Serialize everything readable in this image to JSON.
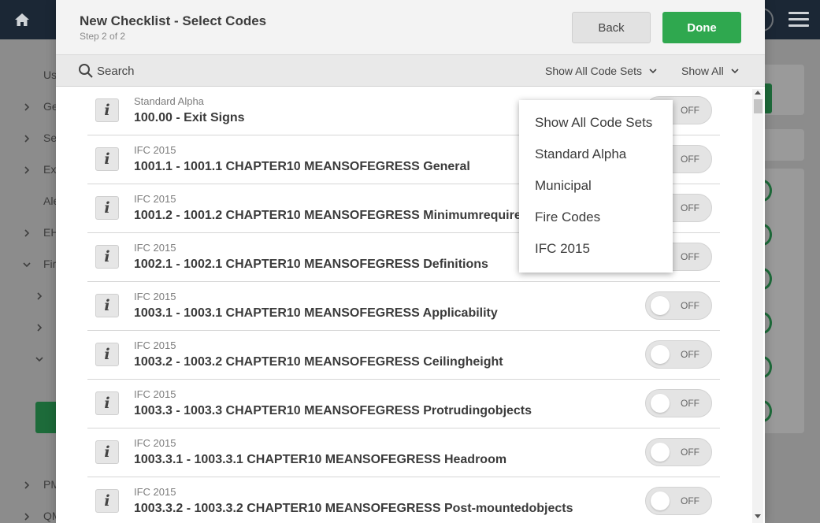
{
  "background": {
    "nav_items": [
      {
        "label": "Us",
        "chevron": ""
      },
      {
        "label": "Ge",
        "chevron": "right"
      },
      {
        "label": "Se",
        "chevron": "right"
      },
      {
        "label": "Ex",
        "chevron": "right"
      },
      {
        "label": "Ale",
        "chevron": ""
      },
      {
        "label": "EH",
        "chevron": "right"
      },
      {
        "label": "Fir",
        "chevron": "down"
      },
      {
        "label": "PM",
        "chevron": "right"
      },
      {
        "label": "QM",
        "chevron": "right"
      }
    ]
  },
  "modal": {
    "title": "New Checklist - Select Codes",
    "step": "Step 2 of 2",
    "back_label": "Back",
    "done_label": "Done"
  },
  "filterbar": {
    "search_placeholder": "Search",
    "code_sets_dropdown": "Show All Code Sets",
    "show_dropdown": "Show All"
  },
  "codes": [
    {
      "set": "Standard Alpha",
      "code": "100.00 - Exit Signs",
      "state": "OFF"
    },
    {
      "set": "IFC 2015",
      "code": "1001.1 - 1001.1 CHAPTER10 MEANSOFEGRESS General",
      "state": "OFF"
    },
    {
      "set": "IFC 2015",
      "code": "1001.2 - 1001.2 CHAPTER10 MEANSOFEGRESS Minimumrequiren",
      "state": "OFF"
    },
    {
      "set": "IFC 2015",
      "code": "1002.1 - 1002.1 CHAPTER10 MEANSOFEGRESS Definitions",
      "state": "OFF"
    },
    {
      "set": "IFC 2015",
      "code": "1003.1 - 1003.1 CHAPTER10 MEANSOFEGRESS Applicability",
      "state": "OFF"
    },
    {
      "set": "IFC 2015",
      "code": "1003.2 - 1003.2 CHAPTER10 MEANSOFEGRESS Ceilingheight",
      "state": "OFF"
    },
    {
      "set": "IFC 2015",
      "code": "1003.3 - 1003.3 CHAPTER10 MEANSOFEGRESS Protrudingobjects",
      "state": "OFF"
    },
    {
      "set": "IFC 2015",
      "code": "1003.3.1 - 1003.3.1 CHAPTER10 MEANSOFEGRESS Headroom",
      "state": "OFF"
    },
    {
      "set": "IFC 2015",
      "code": "1003.3.2 - 1003.3.2 CHAPTER10 MEANSOFEGRESS Post-mountedobjects",
      "state": "OFF"
    }
  ],
  "code_set_options": [
    "Show All Code Sets",
    "Standard Alpha",
    "Municipal",
    "Fire Codes",
    "IFC 2015"
  ],
  "colors": {
    "primary_green": "#2fa84f",
    "topbar": "#1b2735"
  }
}
